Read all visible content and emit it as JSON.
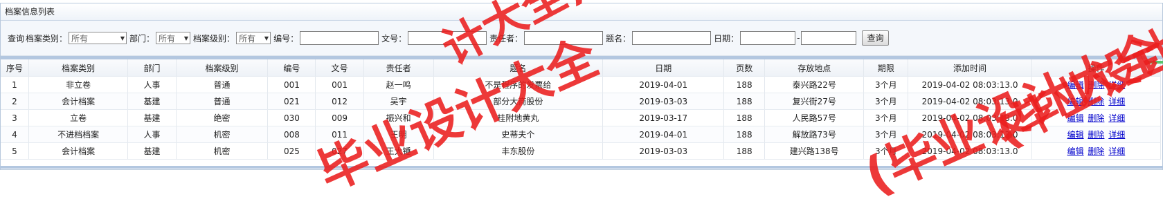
{
  "panel": {
    "title": "档案信息列表"
  },
  "search": {
    "query_label": "查询",
    "fields": [
      {
        "label": "档案类别：",
        "value": "所有"
      },
      {
        "label": "部门：",
        "value": "所有"
      },
      {
        "label": "档案级别：",
        "value": "所有"
      }
    ],
    "number_label": "编号：",
    "docno_label": "文号：",
    "owner_label": "责任者：",
    "title_label": "题名：",
    "date_label": "日期：",
    "date_separator": "-",
    "button_label": "查询"
  },
  "table": {
    "headers": [
      "序号",
      "档案类别",
      "部门",
      "档案级别",
      "编号",
      "文号",
      "责任者",
      "题名",
      "日期",
      "页数",
      "存放地点",
      "期限",
      "添加时间",
      "操作"
    ],
    "rows": [
      [
        "1",
        "非立卷",
        "人事",
        "普通",
        "001",
        "001",
        "赵一鸣",
        "不是程序的发票给",
        "2019-04-01",
        "188",
        "泰兴路22号",
        "3个月",
        "2019-04-02 08:03:13.0"
      ],
      [
        "2",
        "会计档案",
        "基建",
        "普通",
        "021",
        "012",
        "吴宇",
        "部分大商股份",
        "2019-03-03",
        "188",
        "复兴街27号",
        "3个月",
        "2019-04-02 08:03:13.0"
      ],
      [
        "3",
        "立卷",
        "基建",
        "绝密",
        "030",
        "009",
        "振兴和",
        "桂附地黄丸",
        "2019-03-17",
        "188",
        "人民路57号",
        "3个月",
        "2019-04-02 08:03:13.0"
      ],
      [
        "4",
        "不进档档案",
        "人事",
        "机密",
        "008",
        "011",
        "王明",
        "史蒂夫个",
        "2019-04-01",
        "188",
        "解放路73号",
        "3个月",
        "2019-04-02 08:03:13.0"
      ],
      [
        "5",
        "会计档案",
        "基建",
        "机密",
        "025",
        "027",
        "王大锤",
        "丰东股份",
        "2019-03-03",
        "188",
        "建兴路138号",
        "3个月",
        "2019-04-02 08:03:13.0"
      ]
    ],
    "actions": [
      "编辑",
      "删除",
      "详细"
    ]
  },
  "watermarks": [
    "计大全)",
    "毕业设计大全",
    "(毕业设计大全",
    "(毕业设计大"
  ],
  "colors": {
    "watermark": "#e81e1e",
    "band": "#b3c7e0",
    "link": "#0000cc"
  }
}
